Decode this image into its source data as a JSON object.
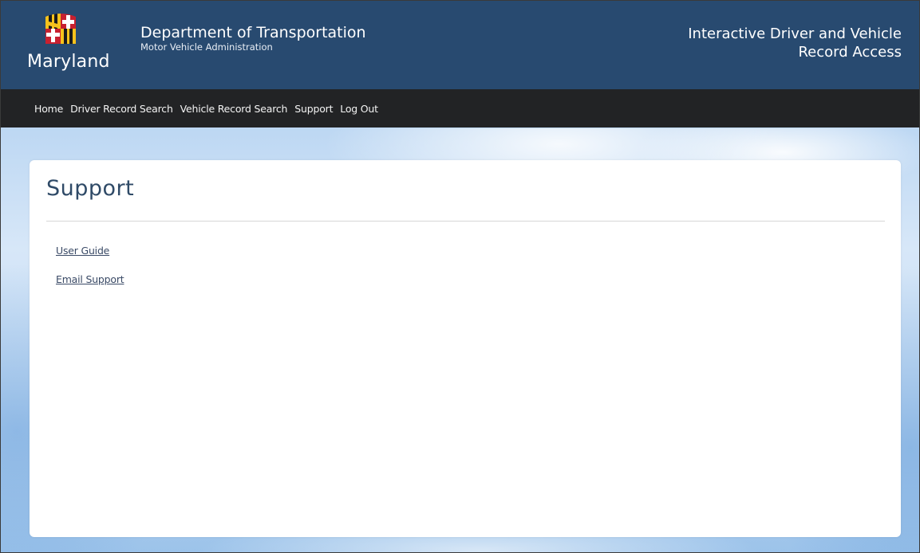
{
  "header": {
    "logo_text": "Maryland",
    "department": "Department of Transportation",
    "administration": "Motor Vehicle Administration",
    "app_title_line1": "Interactive Driver and Vehicle",
    "app_title_line2": "Record Access",
    "background_color": "#284a70"
  },
  "nav": {
    "background_color": "#222325",
    "items": [
      {
        "label": "Home"
      },
      {
        "label": "Driver Record Search"
      },
      {
        "label": "Vehicle Record Search"
      },
      {
        "label": "Support"
      },
      {
        "label": "Log Out"
      }
    ]
  },
  "main": {
    "title": "Support",
    "links": [
      {
        "label": "User Guide"
      },
      {
        "label": "Email Support"
      }
    ]
  },
  "icons": {
    "logo": "maryland-flag-icon"
  }
}
